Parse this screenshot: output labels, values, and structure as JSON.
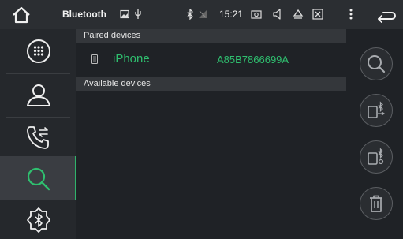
{
  "statusbar": {
    "title": "Bluetooth",
    "time": "15:21",
    "icons": [
      "home-icon",
      "gallery-icon",
      "usb-icon",
      "bluetooth-icon",
      "no-signal-icon",
      "camera-icon",
      "volume-icon",
      "eject-icon",
      "close-box-icon",
      "more-icon",
      "back-icon"
    ]
  },
  "sidebar": {
    "items": [
      {
        "icon": "dialpad-icon",
        "active": false
      },
      {
        "icon": "contacts-icon",
        "active": false
      },
      {
        "icon": "call-log-icon",
        "active": false
      },
      {
        "icon": "search-icon",
        "active": true
      },
      {
        "icon": "bluetooth-settings-icon",
        "active": false
      }
    ]
  },
  "main": {
    "paired_header": "Paired devices",
    "available_header": "Available devices",
    "paired_devices": [
      {
        "name": "iPhone",
        "address": "A85B7866699A"
      }
    ]
  },
  "rightbar": {
    "buttons": [
      "search-icon",
      "connect-phone-icon",
      "disconnect-phone-icon",
      "delete-icon"
    ]
  },
  "colors": {
    "accent": "#2fbf6f",
    "background": "#1f2226",
    "statusbar": "#2b2e32"
  }
}
